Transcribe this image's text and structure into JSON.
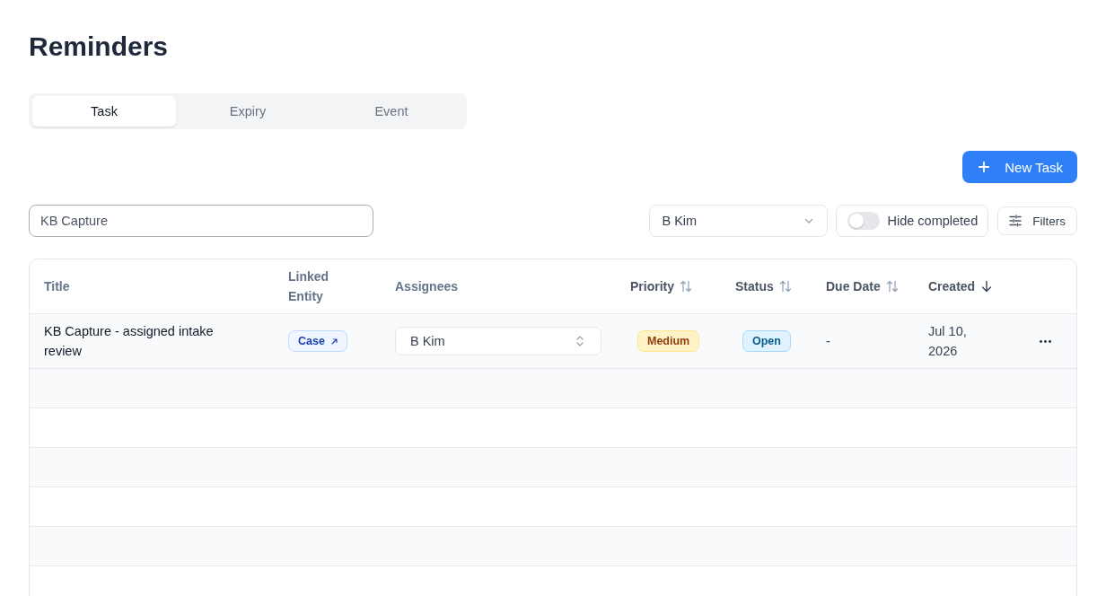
{
  "page": {
    "title": "Reminders"
  },
  "tabs": [
    {
      "label": "Task",
      "selected": true
    },
    {
      "label": "Expiry",
      "selected": false
    },
    {
      "label": "Event",
      "selected": false
    }
  ],
  "toolbar": {
    "new_task_button": {
      "label": "New Task"
    }
  },
  "filters": {
    "search": {
      "value": "KB Capture"
    },
    "assignee_select": {
      "value": "B Kim"
    },
    "hide_completed": {
      "label": "Hide completed",
      "on": false
    },
    "filters_button": {
      "label": "Filters"
    }
  },
  "table": {
    "columns": [
      {
        "label": "Title",
        "sortable": false
      },
      {
        "label": "Linked Entity",
        "sortable": false
      },
      {
        "label": "Assignees",
        "sortable": false
      },
      {
        "label": "Priority",
        "sortable": true,
        "sorted": false
      },
      {
        "label": "Status",
        "sortable": true,
        "sorted": false
      },
      {
        "label": "Due Date",
        "sortable": true,
        "sorted": false
      },
      {
        "label": "Created",
        "sortable": true,
        "sorted": true,
        "descending": true
      }
    ],
    "rows": [
      {
        "title": "KB Capture - assigned intake review",
        "linked_entity": {
          "label": "Case"
        },
        "assignee": {
          "value": "B Kim"
        },
        "priority": {
          "label": "Medium",
          "color": "#fef3c7"
        },
        "status": {
          "label": "Open",
          "color": "#e0f2fe"
        },
        "due_date": "-",
        "created": "Jul 10, 2026"
      }
    ]
  }
}
